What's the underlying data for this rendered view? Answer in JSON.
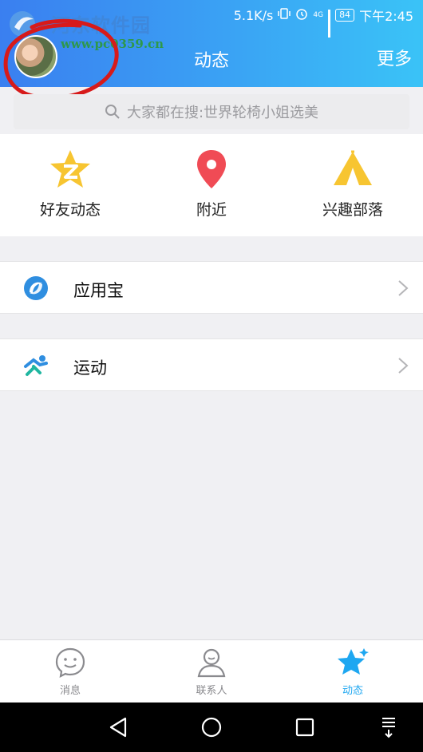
{
  "status": {
    "speed": "5.1K/s",
    "network": "4G",
    "battery": "84",
    "time": "下午2:45"
  },
  "watermark": {
    "title": "河东软件园",
    "url": "www.pc0359.cn"
  },
  "header": {
    "title": "动态",
    "more_label": "更多"
  },
  "search": {
    "placeholder": "大家都在搜:世界轮椅小姐选美"
  },
  "quick": [
    {
      "label": "好友动态",
      "icon": "friends-feed-star-icon"
    },
    {
      "label": "附近",
      "icon": "location-pin-icon"
    },
    {
      "label": "兴趣部落",
      "icon": "tent-icon"
    }
  ],
  "rows": [
    {
      "label": "应用宝",
      "icon": "app-store-icon"
    },
    {
      "label": "运动",
      "icon": "running-icon"
    }
  ],
  "tabs": [
    {
      "label": "消息",
      "icon": "message-bubble-icon",
      "active": false
    },
    {
      "label": "联系人",
      "icon": "contacts-person-icon",
      "active": false
    },
    {
      "label": "动态",
      "icon": "star-icon",
      "active": true
    }
  ],
  "colors": {
    "accent": "#1ea7f1",
    "header_start": "#3a7ff0",
    "header_end": "#3ac3f7",
    "star_yellow": "#f7c531",
    "pin_red": "#f04b55",
    "annotation_red": "#d71a1a"
  }
}
